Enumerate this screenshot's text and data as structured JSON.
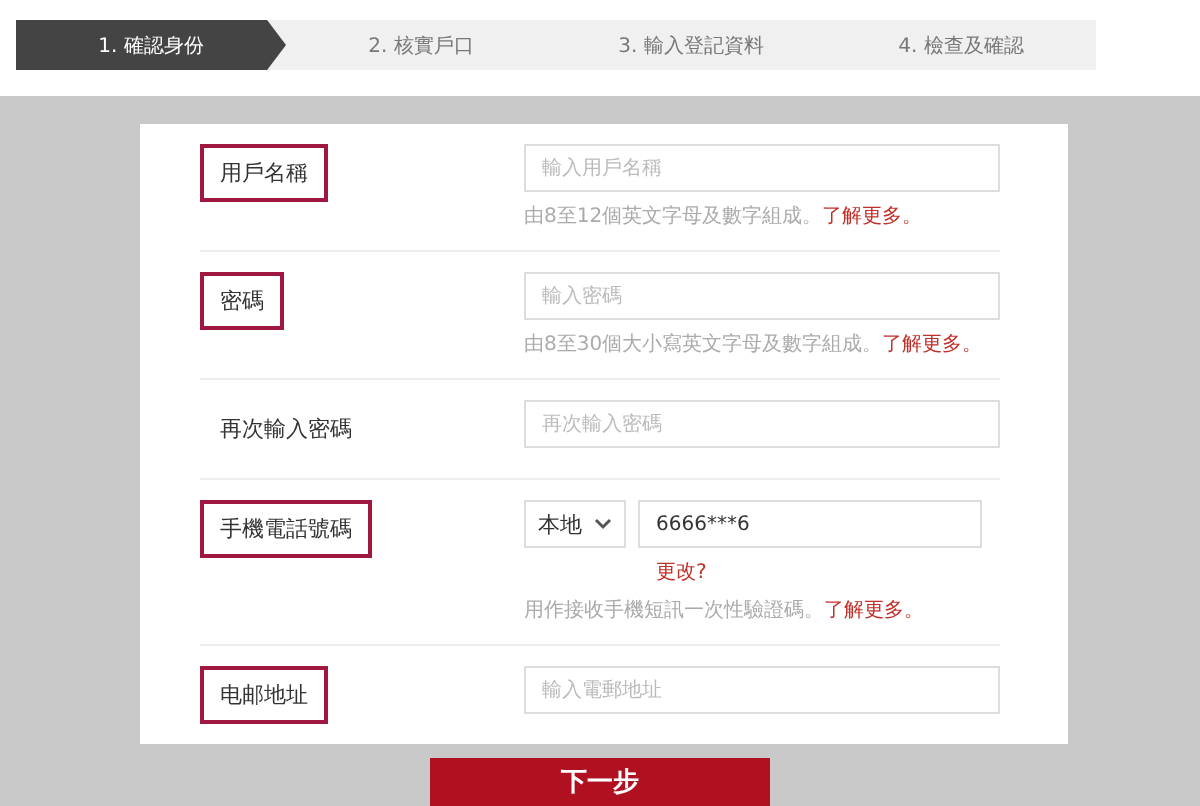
{
  "steps": [
    {
      "label": "1. 確認身份",
      "selected": true
    },
    {
      "label": "2. 核實戶口",
      "selected": false
    },
    {
      "label": "3. 輸入登記資料",
      "selected": false
    },
    {
      "label": "4. 檢查及確認",
      "selected": false
    }
  ],
  "fields": [
    {
      "kind": "text",
      "label": "用戶名稱",
      "highlighted": true,
      "placeholder": "輸入用戶名稱",
      "hint": "由8至12個英文字母及數字組成。",
      "hint_link": "了解更多。"
    },
    {
      "kind": "text",
      "label": "密碼",
      "highlighted": true,
      "placeholder": "輸入密碼",
      "hint": "由8至30個大小寫英文字母及數字組成。",
      "hint_link": "了解更多。"
    },
    {
      "kind": "text",
      "label": "再次輸入密碼",
      "highlighted": false,
      "placeholder": "再次輸入密碼"
    },
    {
      "kind": "phone",
      "label": "手機電話號碼",
      "highlighted": true,
      "region": "本地",
      "value": "6666***6",
      "change_link": "更改?",
      "hint": "用作接收手機短訊一次性驗證碼。",
      "hint_link": "了解更多。"
    },
    {
      "kind": "text",
      "label": "电邮地址",
      "highlighted": true,
      "placeholder": "輸入電郵地址"
    }
  ],
  "next_button": "下一步"
}
